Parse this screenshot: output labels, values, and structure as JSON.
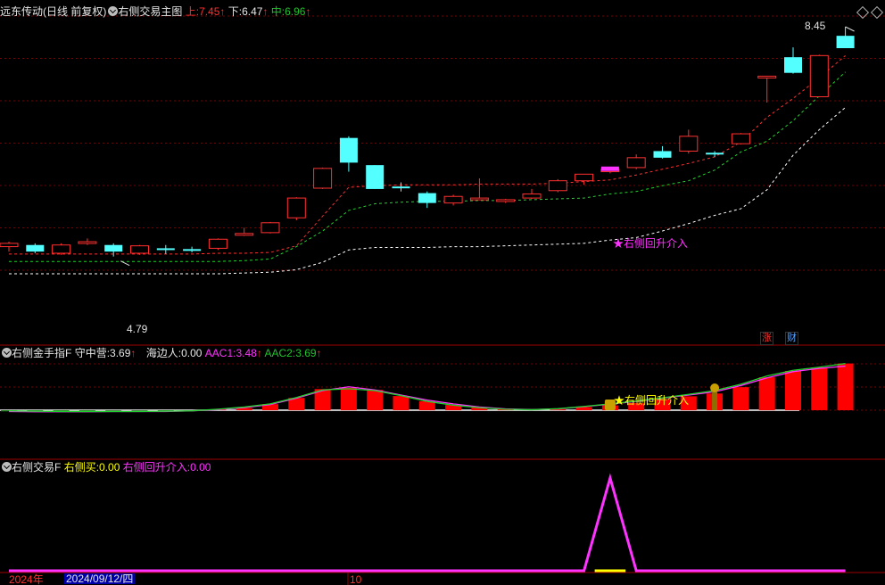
{
  "main": {
    "stock": "远东传动(日线 前复权)",
    "indicator": "右侧交易主图",
    "up_label": "上:",
    "up_value": "7.45",
    "down_label": "下:",
    "down_value": "6.47",
    "mid_label": "中:",
    "mid_value": "6.96",
    "high_label": "8.45",
    "low_label": "4.79",
    "signal_label": "★右侧回升介入",
    "zhang": "涨",
    "cai": "财"
  },
  "sub1": {
    "name": "右侧金手指F",
    "a_label": "守中营:",
    "a_value": "3.69",
    "b_label": "海边人:",
    "b_value": "0.00",
    "c_label": "AAC1:",
    "c_value": "3.48",
    "d_label": "AAC2:",
    "d_value": "3.69",
    "signal_label": "★右侧回升介入"
  },
  "sub2": {
    "name": "右侧交易F",
    "a_label": "右侧买:",
    "a_value": "0.00",
    "b_label": "右侧回升介入:",
    "b_value": "0.00"
  },
  "footer": {
    "year": "2024年",
    "date": "2024/09/12/四",
    "month": "10"
  },
  "colors": {
    "up": "#ff3030",
    "down": "#54ffff",
    "mid_line": "#22c22e",
    "magenta": "#ff33ff",
    "yellow": "#ffff00",
    "grid": "#7a0000",
    "frame": "#a00000"
  },
  "chart_data": [
    {
      "type": "candlestick",
      "title": "远东传动(日线 前复权)",
      "candles": [
        {
          "o": 5.78,
          "h": 5.84,
          "l": 5.72,
          "c": 5.82
        },
        {
          "o": 5.8,
          "h": 5.82,
          "l": 5.7,
          "c": 5.72
        },
        {
          "o": 5.7,
          "h": 5.82,
          "l": 5.68,
          "c": 5.8
        },
        {
          "o": 5.82,
          "h": 5.88,
          "l": 5.8,
          "c": 5.84
        },
        {
          "o": 5.8,
          "h": 5.82,
          "l": 5.66,
          "c": 5.72
        },
        {
          "o": 5.7,
          "h": 5.8,
          "l": 5.68,
          "c": 5.79
        },
        {
          "o": 5.76,
          "h": 5.8,
          "l": 5.69,
          "c": 5.75
        },
        {
          "o": 5.75,
          "h": 5.78,
          "l": 5.71,
          "c": 5.73
        },
        {
          "o": 5.76,
          "h": 5.88,
          "l": 5.74,
          "c": 5.87
        },
        {
          "o": 5.93,
          "h": 6.01,
          "l": 5.91,
          "c": 5.94
        },
        {
          "o": 5.95,
          "h": 6.08,
          "l": 5.94,
          "c": 6.07
        },
        {
          "o": 6.13,
          "h": 6.38,
          "l": 6.1,
          "c": 6.37
        },
        {
          "o": 6.49,
          "h": 6.74,
          "l": 6.48,
          "c": 6.73
        },
        {
          "o": 7.1,
          "h": 7.12,
          "l": 6.69,
          "c": 6.8
        },
        {
          "o": 6.77,
          "h": 6.77,
          "l": 6.48,
          "c": 6.48
        },
        {
          "o": 6.51,
          "h": 6.56,
          "l": 6.45,
          "c": 6.49
        },
        {
          "o": 6.43,
          "h": 6.45,
          "l": 6.25,
          "c": 6.31
        },
        {
          "o": 6.31,
          "h": 6.41,
          "l": 6.28,
          "c": 6.39
        },
        {
          "o": 6.37,
          "h": 6.61,
          "l": 6.37,
          "c": 6.37
        },
        {
          "o": 6.33,
          "h": 6.36,
          "l": 6.31,
          "c": 6.35
        },
        {
          "o": 6.37,
          "h": 6.48,
          "l": 6.36,
          "c": 6.42
        },
        {
          "o": 6.46,
          "h": 6.6,
          "l": 6.44,
          "c": 6.58
        },
        {
          "o": 6.58,
          "h": 6.66,
          "l": 6.53,
          "c": 6.66
        },
        {
          "o": 6.69,
          "h": 6.74,
          "l": 6.67,
          "c": 6.72
        },
        {
          "o": 6.74,
          "h": 6.9,
          "l": 6.72,
          "c": 6.86
        },
        {
          "o": 6.94,
          "h": 7.0,
          "l": 6.85,
          "c": 6.86
        },
        {
          "o": 6.94,
          "h": 7.2,
          "l": 6.91,
          "c": 7.12
        },
        {
          "o": 6.92,
          "h": 6.94,
          "l": 6.87,
          "c": 6.91
        },
        {
          "o": 7.03,
          "h": 7.16,
          "l": 7.02,
          "c": 7.15
        },
        {
          "o": 7.85,
          "h": 7.85,
          "l": 7.53,
          "c": 7.85
        },
        {
          "o": 8.08,
          "h": 8.2,
          "l": 7.88,
          "c": 7.89
        },
        {
          "o": 7.6,
          "h": 8.11,
          "l": 7.6,
          "c": 8.1
        },
        {
          "o": 8.34,
          "h": 8.45,
          "l": 8.19,
          "c": 8.19
        }
      ],
      "lines": {
        "upper": [
          5.69,
          5.69,
          5.69,
          5.69,
          5.69,
          5.69,
          5.69,
          5.69,
          5.7,
          5.7,
          5.71,
          5.79,
          6.15,
          6.5,
          6.52,
          6.53,
          6.53,
          6.53,
          6.54,
          6.54,
          6.54,
          6.55,
          6.57,
          6.59,
          6.65,
          6.72,
          6.79,
          6.87,
          7.05,
          7.35,
          7.58,
          7.83,
          8.1
        ],
        "mid": [
          5.6,
          5.6,
          5.6,
          5.6,
          5.6,
          5.6,
          5.6,
          5.6,
          5.6,
          5.61,
          5.63,
          5.78,
          5.97,
          6.22,
          6.3,
          6.32,
          6.33,
          6.33,
          6.34,
          6.34,
          6.35,
          6.36,
          6.37,
          6.42,
          6.45,
          6.52,
          6.58,
          6.71,
          6.93,
          7.06,
          7.31,
          7.61,
          7.9
        ],
        "lower": [
          5.45,
          5.45,
          5.45,
          5.45,
          5.45,
          5.45,
          5.45,
          5.45,
          5.45,
          5.46,
          5.47,
          5.5,
          5.59,
          5.74,
          5.77,
          5.77,
          5.77,
          5.78,
          5.78,
          5.79,
          5.8,
          5.81,
          5.82,
          5.86,
          5.89,
          5.97,
          6.06,
          6.16,
          6.24,
          6.47,
          6.89,
          7.2,
          7.47
        ]
      }
    },
    {
      "type": "bar",
      "title": "右侧金手指F",
      "values": [
        0,
        0,
        0,
        0,
        0,
        0,
        0,
        0,
        0.05,
        0.18,
        0.48,
        0.97,
        1.67,
        1.77,
        1.6,
        1.12,
        0.71,
        0.41,
        0.23,
        0.1,
        0.03,
        0.08,
        0.25,
        0.38,
        0.57,
        0.85,
        1.1,
        1.32,
        1.82,
        2.6,
        3.1,
        3.38,
        3.69
      ],
      "neg_values": [
        0.22,
        0.35,
        0.3,
        0.34,
        0.3,
        0.28,
        0.25,
        0.15,
        0,
        0,
        0,
        0,
        0,
        0,
        0,
        0,
        0,
        0,
        0,
        0,
        0,
        0,
        0,
        0,
        0,
        0,
        0,
        0,
        0,
        0,
        0,
        0,
        0
      ],
      "series": [
        {
          "name": "AAC1",
          "values": [
            -0.1,
            -0.12,
            -0.12,
            -0.12,
            -0.1,
            -0.1,
            -0.1,
            -0.05,
            0.05,
            0.2,
            0.45,
            0.95,
            1.55,
            1.85,
            1.6,
            1.2,
            0.8,
            0.5,
            0.25,
            0.1,
            0.05,
            0.1,
            0.28,
            0.48,
            0.7,
            0.95,
            1.2,
            1.45,
            1.95,
            2.55,
            3.05,
            3.3,
            3.48
          ]
        },
        {
          "name": "AAC2",
          "values": [
            -0.05,
            -0.08,
            -0.1,
            -0.1,
            -0.1,
            -0.1,
            -0.08,
            -0.05,
            0.08,
            0.25,
            0.5,
            1.0,
            1.6,
            1.7,
            1.55,
            1.15,
            0.7,
            0.4,
            0.2,
            0.08,
            0.04,
            0.12,
            0.3,
            0.5,
            0.72,
            0.98,
            1.25,
            1.55,
            2.05,
            2.7,
            3.15,
            3.4,
            3.69
          ]
        }
      ]
    },
    {
      "type": "line",
      "title": "右侧交易F",
      "series": [
        {
          "name": "右侧回升介入",
          "values": [
            0,
            0,
            0,
            0,
            0,
            0,
            0,
            0,
            0,
            0,
            0,
            0,
            0,
            0,
            0,
            0,
            0,
            0,
            0,
            0,
            0,
            0,
            0,
            1,
            0,
            0,
            0,
            0,
            0,
            0,
            0,
            0,
            0
          ]
        },
        {
          "name": "右侧买",
          "values": [
            0,
            0,
            0,
            0,
            0,
            0,
            0,
            0,
            0,
            0,
            0,
            0,
            0,
            0,
            0,
            0,
            0,
            0,
            0,
            0,
            0,
            0,
            0,
            0,
            0,
            0,
            0,
            0,
            0,
            0,
            0,
            0,
            0
          ]
        }
      ]
    }
  ]
}
